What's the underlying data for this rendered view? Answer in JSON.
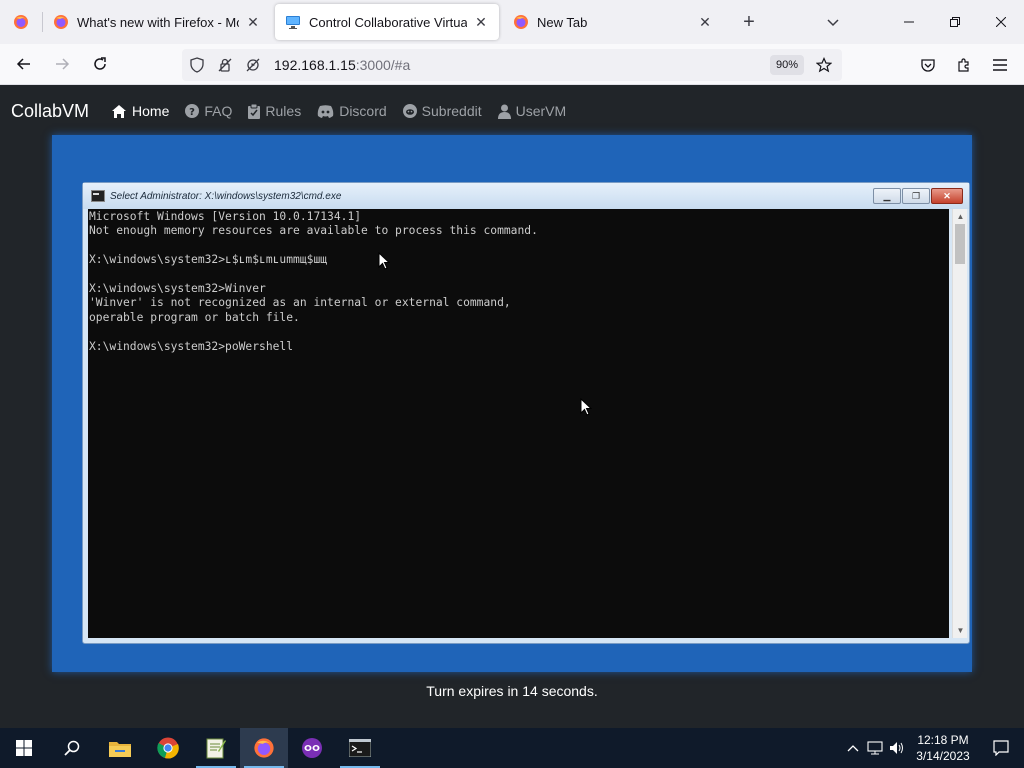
{
  "browser": {
    "tabs": [
      {
        "title": "What's new with Firefox - More",
        "icon": "firefox-icon",
        "active": false
      },
      {
        "title": "Control Collaborative Virtual M",
        "icon": "monitor-icon",
        "active": true
      },
      {
        "title": "New Tab",
        "icon": "firefox-icon",
        "active": false
      }
    ],
    "url_host": "192.168.1.15",
    "url_path": ":3000/#a",
    "zoom": "90%"
  },
  "collabvm": {
    "brand": "CollabVM",
    "nav": [
      {
        "label": "Home",
        "icon": "home-icon",
        "active": true
      },
      {
        "label": "FAQ",
        "icon": "question-icon"
      },
      {
        "label": "Rules",
        "icon": "clipboard-icon"
      },
      {
        "label": "Discord",
        "icon": "discord-icon"
      },
      {
        "label": "Subreddit",
        "icon": "reddit-icon"
      },
      {
        "label": "UserVM",
        "icon": "user-icon"
      }
    ],
    "turn_text": "Turn expires in 14 seconds."
  },
  "cmd": {
    "title": "Select Administrator: X:\\windows\\system32\\cmd.exe",
    "lines": [
      "Microsoft Windows [Version 10.0.17134.1]",
      "Not enough memory resources are available to process this command.",
      "",
      "X:\\windows\\system32>ʟ$ʟm$ʟmʟummщ$шщ",
      "",
      "X:\\windows\\system32>Winver",
      "'Winver' is not recognized as an internal or external command,",
      "operable program or batch file.",
      "",
      "X:\\windows\\system32>poWershell"
    ]
  },
  "taskbar": {
    "time": "12:18 PM",
    "date": "3/14/2023"
  },
  "colors": {
    "page_bg": "#212529",
    "vm_blue": "#1f64b8",
    "console_bg": "#0c0c0c",
    "taskbar_bg": "#0f1a2a"
  }
}
